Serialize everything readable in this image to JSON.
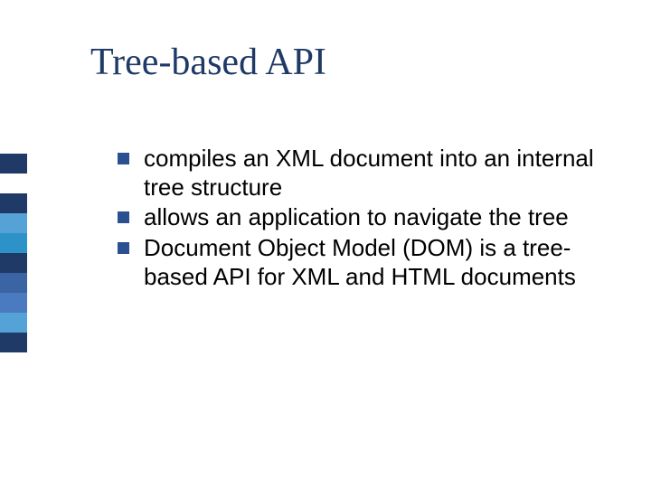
{
  "title": "Tree-based API",
  "sidebar_colors": [
    "#1f3a66",
    "#ffffff",
    "#1f3a66",
    "#55a3d6",
    "#2c92c8",
    "#1f3a66",
    "#3a64a3",
    "#4a7ac0",
    "#55a3d6",
    "#1f3a66",
    "#ffffff"
  ],
  "bullets": [
    {
      "text": "compiles an XML document into an internal tree structure"
    },
    {
      "text": "allows an application to navigate the tree"
    },
    {
      "text": "Document Object Model (DOM) is a tree-based API for XML and HTML documents"
    }
  ]
}
